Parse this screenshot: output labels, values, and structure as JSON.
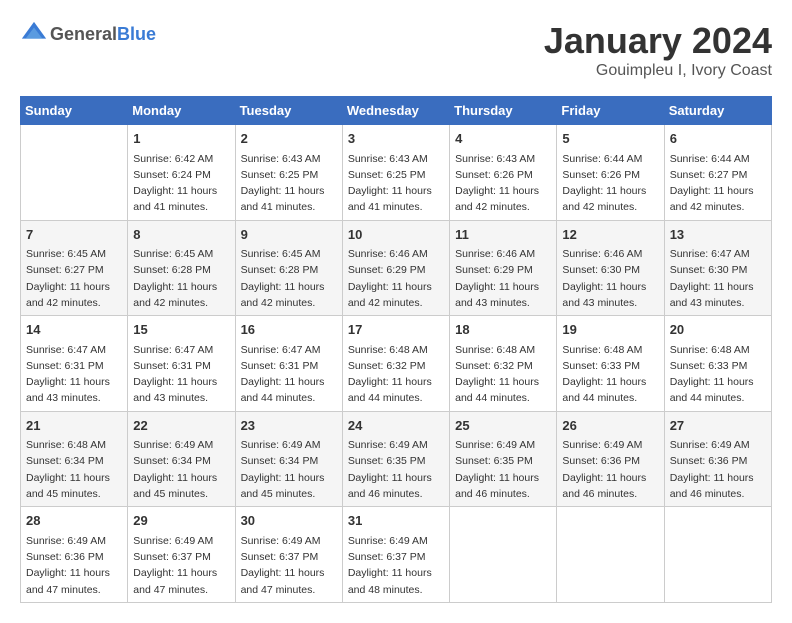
{
  "header": {
    "logo_general": "General",
    "logo_blue": "Blue",
    "month": "January 2024",
    "location": "Gouimpleu I, Ivory Coast"
  },
  "days_of_week": [
    "Sunday",
    "Monday",
    "Tuesday",
    "Wednesday",
    "Thursday",
    "Friday",
    "Saturday"
  ],
  "weeks": [
    [
      {
        "day": "",
        "info": ""
      },
      {
        "day": "1",
        "info": "Sunrise: 6:42 AM\nSunset: 6:24 PM\nDaylight: 11 hours\nand 41 minutes."
      },
      {
        "day": "2",
        "info": "Sunrise: 6:43 AM\nSunset: 6:25 PM\nDaylight: 11 hours\nand 41 minutes."
      },
      {
        "day": "3",
        "info": "Sunrise: 6:43 AM\nSunset: 6:25 PM\nDaylight: 11 hours\nand 41 minutes."
      },
      {
        "day": "4",
        "info": "Sunrise: 6:43 AM\nSunset: 6:26 PM\nDaylight: 11 hours\nand 42 minutes."
      },
      {
        "day": "5",
        "info": "Sunrise: 6:44 AM\nSunset: 6:26 PM\nDaylight: 11 hours\nand 42 minutes."
      },
      {
        "day": "6",
        "info": "Sunrise: 6:44 AM\nSunset: 6:27 PM\nDaylight: 11 hours\nand 42 minutes."
      }
    ],
    [
      {
        "day": "7",
        "info": "Sunrise: 6:45 AM\nSunset: 6:27 PM\nDaylight: 11 hours\nand 42 minutes."
      },
      {
        "day": "8",
        "info": "Sunrise: 6:45 AM\nSunset: 6:28 PM\nDaylight: 11 hours\nand 42 minutes."
      },
      {
        "day": "9",
        "info": "Sunrise: 6:45 AM\nSunset: 6:28 PM\nDaylight: 11 hours\nand 42 minutes."
      },
      {
        "day": "10",
        "info": "Sunrise: 6:46 AM\nSunset: 6:29 PM\nDaylight: 11 hours\nand 42 minutes."
      },
      {
        "day": "11",
        "info": "Sunrise: 6:46 AM\nSunset: 6:29 PM\nDaylight: 11 hours\nand 43 minutes."
      },
      {
        "day": "12",
        "info": "Sunrise: 6:46 AM\nSunset: 6:30 PM\nDaylight: 11 hours\nand 43 minutes."
      },
      {
        "day": "13",
        "info": "Sunrise: 6:47 AM\nSunset: 6:30 PM\nDaylight: 11 hours\nand 43 minutes."
      }
    ],
    [
      {
        "day": "14",
        "info": "Sunrise: 6:47 AM\nSunset: 6:31 PM\nDaylight: 11 hours\nand 43 minutes."
      },
      {
        "day": "15",
        "info": "Sunrise: 6:47 AM\nSunset: 6:31 PM\nDaylight: 11 hours\nand 43 minutes."
      },
      {
        "day": "16",
        "info": "Sunrise: 6:47 AM\nSunset: 6:31 PM\nDaylight: 11 hours\nand 44 minutes."
      },
      {
        "day": "17",
        "info": "Sunrise: 6:48 AM\nSunset: 6:32 PM\nDaylight: 11 hours\nand 44 minutes."
      },
      {
        "day": "18",
        "info": "Sunrise: 6:48 AM\nSunset: 6:32 PM\nDaylight: 11 hours\nand 44 minutes."
      },
      {
        "day": "19",
        "info": "Sunrise: 6:48 AM\nSunset: 6:33 PM\nDaylight: 11 hours\nand 44 minutes."
      },
      {
        "day": "20",
        "info": "Sunrise: 6:48 AM\nSunset: 6:33 PM\nDaylight: 11 hours\nand 44 minutes."
      }
    ],
    [
      {
        "day": "21",
        "info": "Sunrise: 6:48 AM\nSunset: 6:34 PM\nDaylight: 11 hours\nand 45 minutes."
      },
      {
        "day": "22",
        "info": "Sunrise: 6:49 AM\nSunset: 6:34 PM\nDaylight: 11 hours\nand 45 minutes."
      },
      {
        "day": "23",
        "info": "Sunrise: 6:49 AM\nSunset: 6:34 PM\nDaylight: 11 hours\nand 45 minutes."
      },
      {
        "day": "24",
        "info": "Sunrise: 6:49 AM\nSunset: 6:35 PM\nDaylight: 11 hours\nand 46 minutes."
      },
      {
        "day": "25",
        "info": "Sunrise: 6:49 AM\nSunset: 6:35 PM\nDaylight: 11 hours\nand 46 minutes."
      },
      {
        "day": "26",
        "info": "Sunrise: 6:49 AM\nSunset: 6:36 PM\nDaylight: 11 hours\nand 46 minutes."
      },
      {
        "day": "27",
        "info": "Sunrise: 6:49 AM\nSunset: 6:36 PM\nDaylight: 11 hours\nand 46 minutes."
      }
    ],
    [
      {
        "day": "28",
        "info": "Sunrise: 6:49 AM\nSunset: 6:36 PM\nDaylight: 11 hours\nand 47 minutes."
      },
      {
        "day": "29",
        "info": "Sunrise: 6:49 AM\nSunset: 6:37 PM\nDaylight: 11 hours\nand 47 minutes."
      },
      {
        "day": "30",
        "info": "Sunrise: 6:49 AM\nSunset: 6:37 PM\nDaylight: 11 hours\nand 47 minutes."
      },
      {
        "day": "31",
        "info": "Sunrise: 6:49 AM\nSunset: 6:37 PM\nDaylight: 11 hours\nand 48 minutes."
      },
      {
        "day": "",
        "info": ""
      },
      {
        "day": "",
        "info": ""
      },
      {
        "day": "",
        "info": ""
      }
    ]
  ]
}
